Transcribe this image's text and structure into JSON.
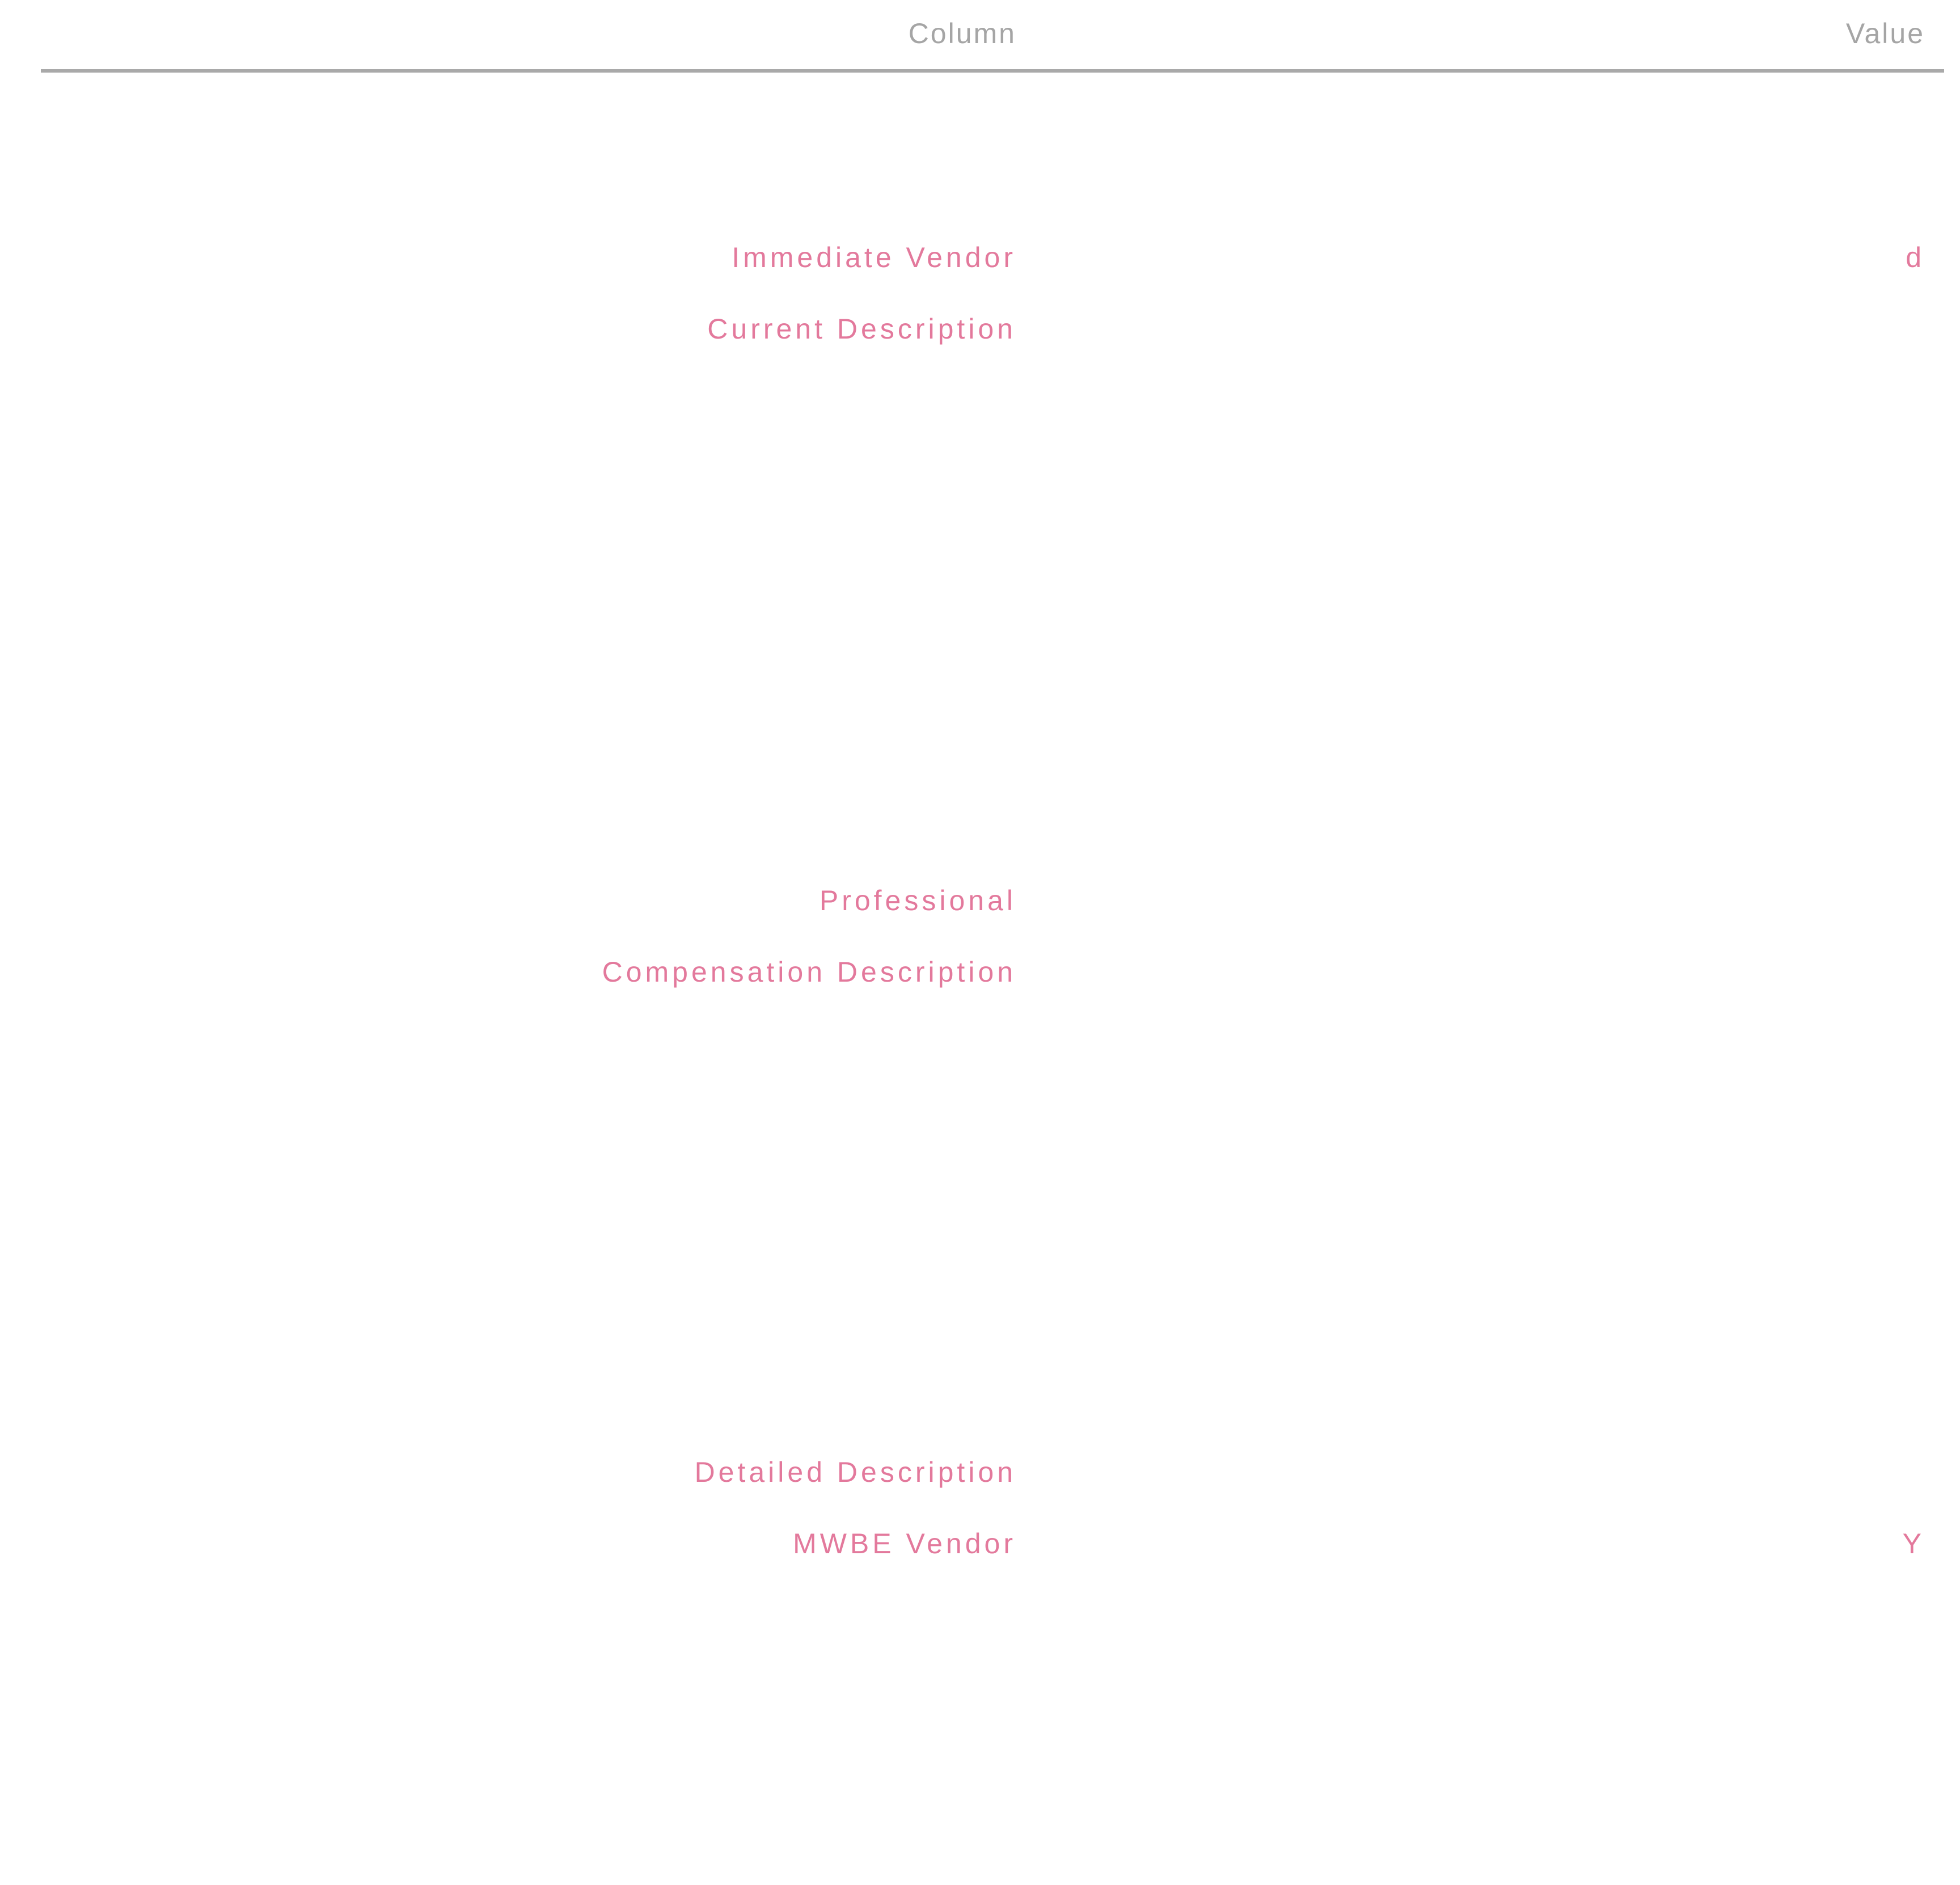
{
  "table": {
    "headers": {
      "column1": "Column",
      "column2": "Value"
    },
    "rows": [
      {
        "name": "",
        "value": "",
        "name_accent": false,
        "value_accent": false
      },
      {
        "name": "",
        "value": "",
        "name_accent": false,
        "value_accent": true
      },
      {
        "name": "Immediate Vendor",
        "value": "d",
        "name_accent": true,
        "value_accent": true
      },
      {
        "name": "Current Description",
        "value": "",
        "name_accent": true,
        "value_accent": false
      },
      {
        "name": "",
        "value": "",
        "name_accent": false,
        "value_accent": false
      },
      {
        "name": "",
        "value": "",
        "name_accent": false,
        "value_accent": false
      },
      {
        "name": "",
        "value": "",
        "name_accent": false,
        "value_accent": false
      },
      {
        "name": "",
        "value": "",
        "name_accent": false,
        "value_accent": false
      },
      {
        "name": "",
        "value": "",
        "name_accent": false,
        "value_accent": false
      },
      {
        "name": "",
        "value": "",
        "name_accent": false,
        "value_accent": false
      },
      {
        "name": "",
        "value": "",
        "name_accent": false,
        "value_accent": true
      },
      {
        "name": "Professional",
        "value": "",
        "name_accent": true,
        "value_accent": false
      },
      {
        "name": "Compensation Description",
        "value": "",
        "name_accent": true,
        "value_accent": false
      },
      {
        "name": "",
        "value": "",
        "name_accent": false,
        "value_accent": false
      },
      {
        "name": "",
        "value": "",
        "name_accent": false,
        "value_accent": false
      },
      {
        "name": "",
        "value": "",
        "name_accent": false,
        "value_accent": false
      },
      {
        "name": "",
        "value": "",
        "name_accent": false,
        "value_accent": false
      },
      {
        "name": "",
        "value": "",
        "name_accent": false,
        "value_accent": false
      },
      {
        "name": "",
        "value": "",
        "name_accent": false,
        "value_accent": false
      },
      {
        "name": "Detailed Description",
        "value": "",
        "name_accent": true,
        "value_accent": true
      },
      {
        "name": "MWBE Vendor",
        "value": "Y",
        "name_accent": true,
        "value_accent": true
      },
      {
        "name": "",
        "value": "",
        "name_accent": true,
        "value_accent": true
      },
      {
        "name": "",
        "value": "",
        "name_accent": false,
        "value_accent": false
      },
      {
        "name": "",
        "value": "",
        "name_accent": false,
        "value_accent": false
      },
      {
        "name": "",
        "value": "",
        "name_accent": false,
        "value_accent": false
      }
    ]
  },
  "colors": {
    "accent": "#e06b92",
    "muted": "#c8c8c8",
    "header_rule": "#a9a9a9"
  }
}
